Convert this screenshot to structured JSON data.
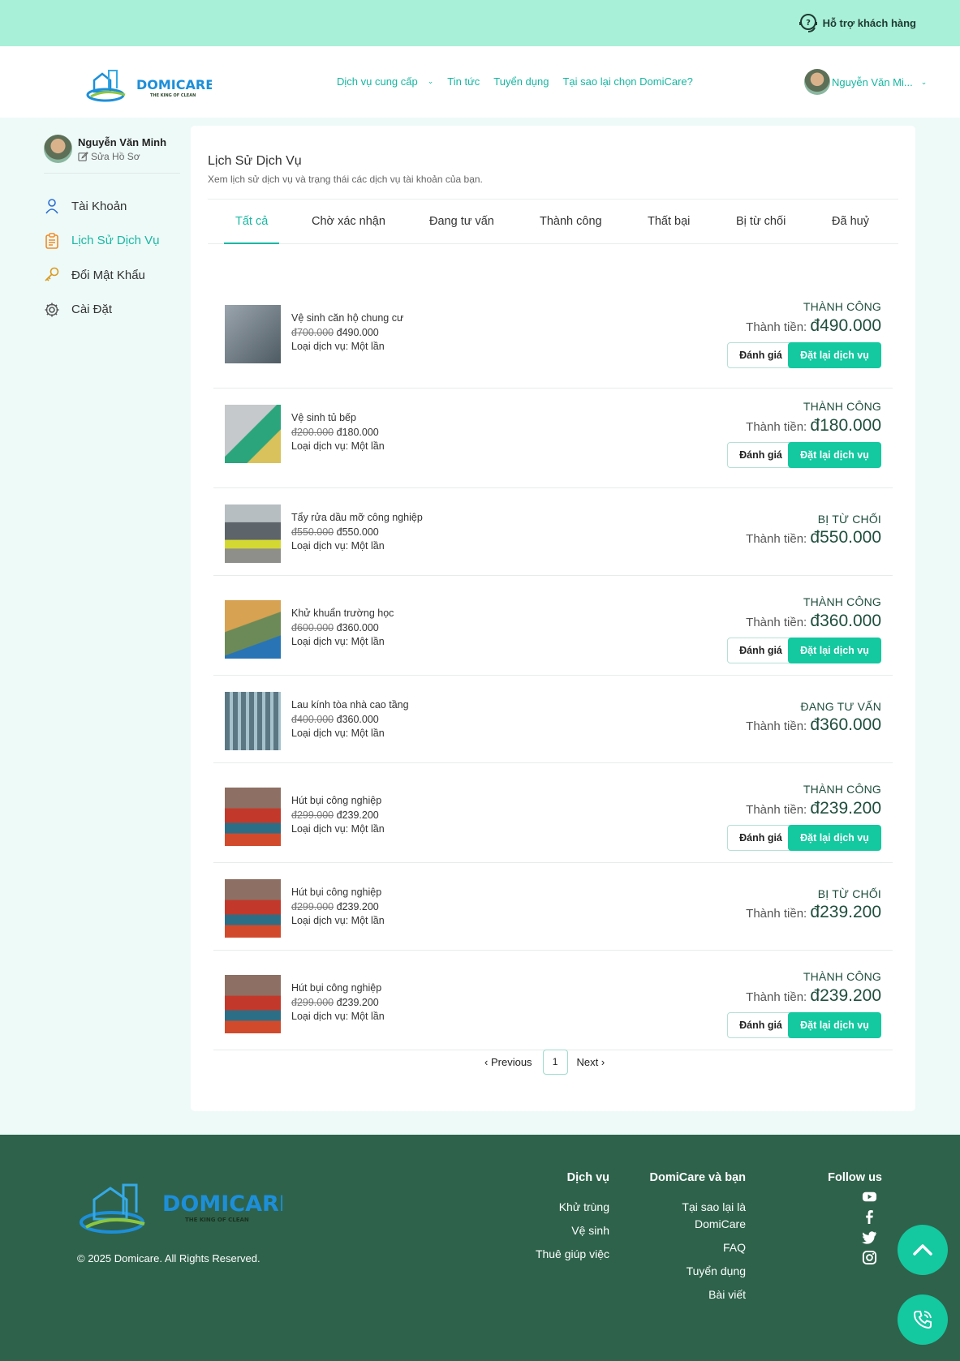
{
  "topbar": {
    "support_label": "Hỗ trợ khách hàng"
  },
  "header": {
    "logo_text": "DOMICARE",
    "logo_tagline": "THE KING OF CLEAN",
    "nav": [
      "Dịch vụ cung cấp",
      "Tin tức",
      "Tuyển dụng",
      "Tại sao lại chọn DomiCare?"
    ],
    "user_name": "Nguyễn Văn Mi..."
  },
  "sidebar": {
    "name": "Nguyễn Văn Minh",
    "edit_label": "Sửa Hồ Sơ",
    "items": [
      "Tài Khoản",
      "Lịch Sử Dịch Vụ",
      "Đổi Mật Khẩu",
      "Cài Đặt"
    ]
  },
  "content": {
    "title": "Lịch Sử Dịch Vụ",
    "subtitle": "Xem lịch sử dịch vụ và trạng thái các dịch vụ tài khoản của bạn.",
    "tabs": [
      "Tất cả",
      "Chờ xác nhận",
      "Đang tư vấn",
      "Thành công",
      "Thất bại",
      "Bị từ chối",
      "Đã huỷ"
    ],
    "total_label": "Thành tiền:",
    "rate_label": "Đánh giá",
    "reorder_label": "Đặt lại dịch vụ",
    "orders": [
      {
        "name": "Vệ sinh căn hộ chung cư",
        "old_price": "đ700.000",
        "price": "đ490.000",
        "type": "Loại dịch vụ: Một lần",
        "status": "THÀNH CÔNG",
        "total": "đ490.000"
      },
      {
        "name": "Vệ sinh tủ bếp",
        "old_price": "đ200.000",
        "price": "đ180.000",
        "type": "Loại dịch vụ: Một lần",
        "status": "THÀNH CÔNG",
        "total": "đ180.000"
      },
      {
        "name": "Tẩy rửa dầu mỡ công nghiệp",
        "old_price": "đ550.000",
        "price": "đ550.000",
        "type": "Loại dịch vụ: Một lần",
        "status": "BỊ TỪ CHỐI",
        "total": "đ550.000"
      },
      {
        "name": "Khử khuẩn trường học",
        "old_price": "đ600.000",
        "price": "đ360.000",
        "type": "Loại dịch vụ: Một lần",
        "status": "THÀNH CÔNG",
        "total": "đ360.000"
      },
      {
        "name": "Lau kính tòa nhà cao tầng",
        "old_price": "đ400.000",
        "price": "đ360.000",
        "type": "Loại dịch vụ: Một lần",
        "status": "ĐANG TƯ VẤN",
        "total": "đ360.000"
      },
      {
        "name": "Hút bụi công nghiệp",
        "old_price": "đ299.000",
        "price": "đ239.200",
        "type": "Loại dịch vụ: Một lần",
        "status": "THÀNH CÔNG",
        "total": "đ239.200"
      },
      {
        "name": "Hút bụi công nghiệp",
        "old_price": "đ299.000",
        "price": "đ239.200",
        "type": "Loại dịch vụ: Một lần",
        "status": "BỊ TỪ CHỐI",
        "total": "đ239.200"
      },
      {
        "name": "Hút bụi công nghiệp",
        "old_price": "đ299.000",
        "price": "đ239.200",
        "type": "Loại dịch vụ: Một lần",
        "status": "THÀNH CÔNG",
        "total": "đ239.200"
      }
    ],
    "pager": {
      "previous": "Previous",
      "page": "1",
      "next": "Next"
    }
  },
  "footer": {
    "copyright": "© 2025 Domicare. All Rights Reserved.",
    "col1": {
      "title": "Dịch vụ",
      "links": [
        "Khử trùng",
        "Vệ sinh",
        "Thuê giúp việc"
      ]
    },
    "col2": {
      "title": "DomiCare và bạn",
      "links": [
        "Tại sao lại là DomiCare",
        "FAQ",
        "Tuyển dụng",
        "Bài viết"
      ]
    },
    "col3": {
      "title": "Follow us",
      "icons": [
        "youtube-icon",
        "facebook-icon",
        "twitter-icon",
        "instagram-icon"
      ]
    }
  },
  "colors": {
    "accent": "#14c8a0",
    "topbar": "#a8f0d8",
    "footer": "#2e624b",
    "status": "#1f4e3d"
  }
}
